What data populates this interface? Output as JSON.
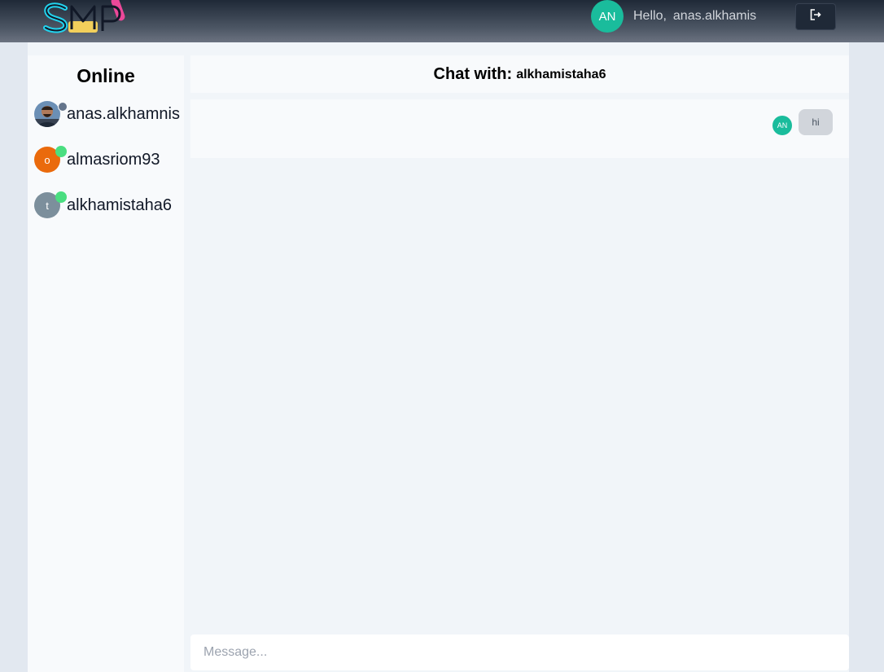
{
  "header": {
    "logo_text": "SMP",
    "avatar_initials": "AN",
    "greeting": "Hello,",
    "username": "anas.alkhamis",
    "logout_icon": "logout-icon"
  },
  "sidebar": {
    "title": "Online",
    "users": [
      {
        "name": "anas.alkhamnis",
        "avatar": "photo",
        "status": "away",
        "status_color": "#64748b"
      },
      {
        "name": "almasriom93",
        "avatar_letter": "o",
        "avatar_color": "#ea6a0c",
        "status": "online",
        "status_color": "#4ade80"
      },
      {
        "name": "alkhamistaha6",
        "avatar_letter": "t",
        "avatar_color": "#7c8f9c",
        "status": "online",
        "status_color": "#4ade80"
      }
    ]
  },
  "chat": {
    "header_label": "Chat with:",
    "partner": "alkhamistaha6",
    "messages": [
      {
        "sender_initials": "AN",
        "text": "hi"
      }
    ],
    "input_placeholder": "Message..."
  },
  "colors": {
    "accent": "#1abc9c",
    "topbar": "#374151",
    "online": "#4ade80"
  }
}
